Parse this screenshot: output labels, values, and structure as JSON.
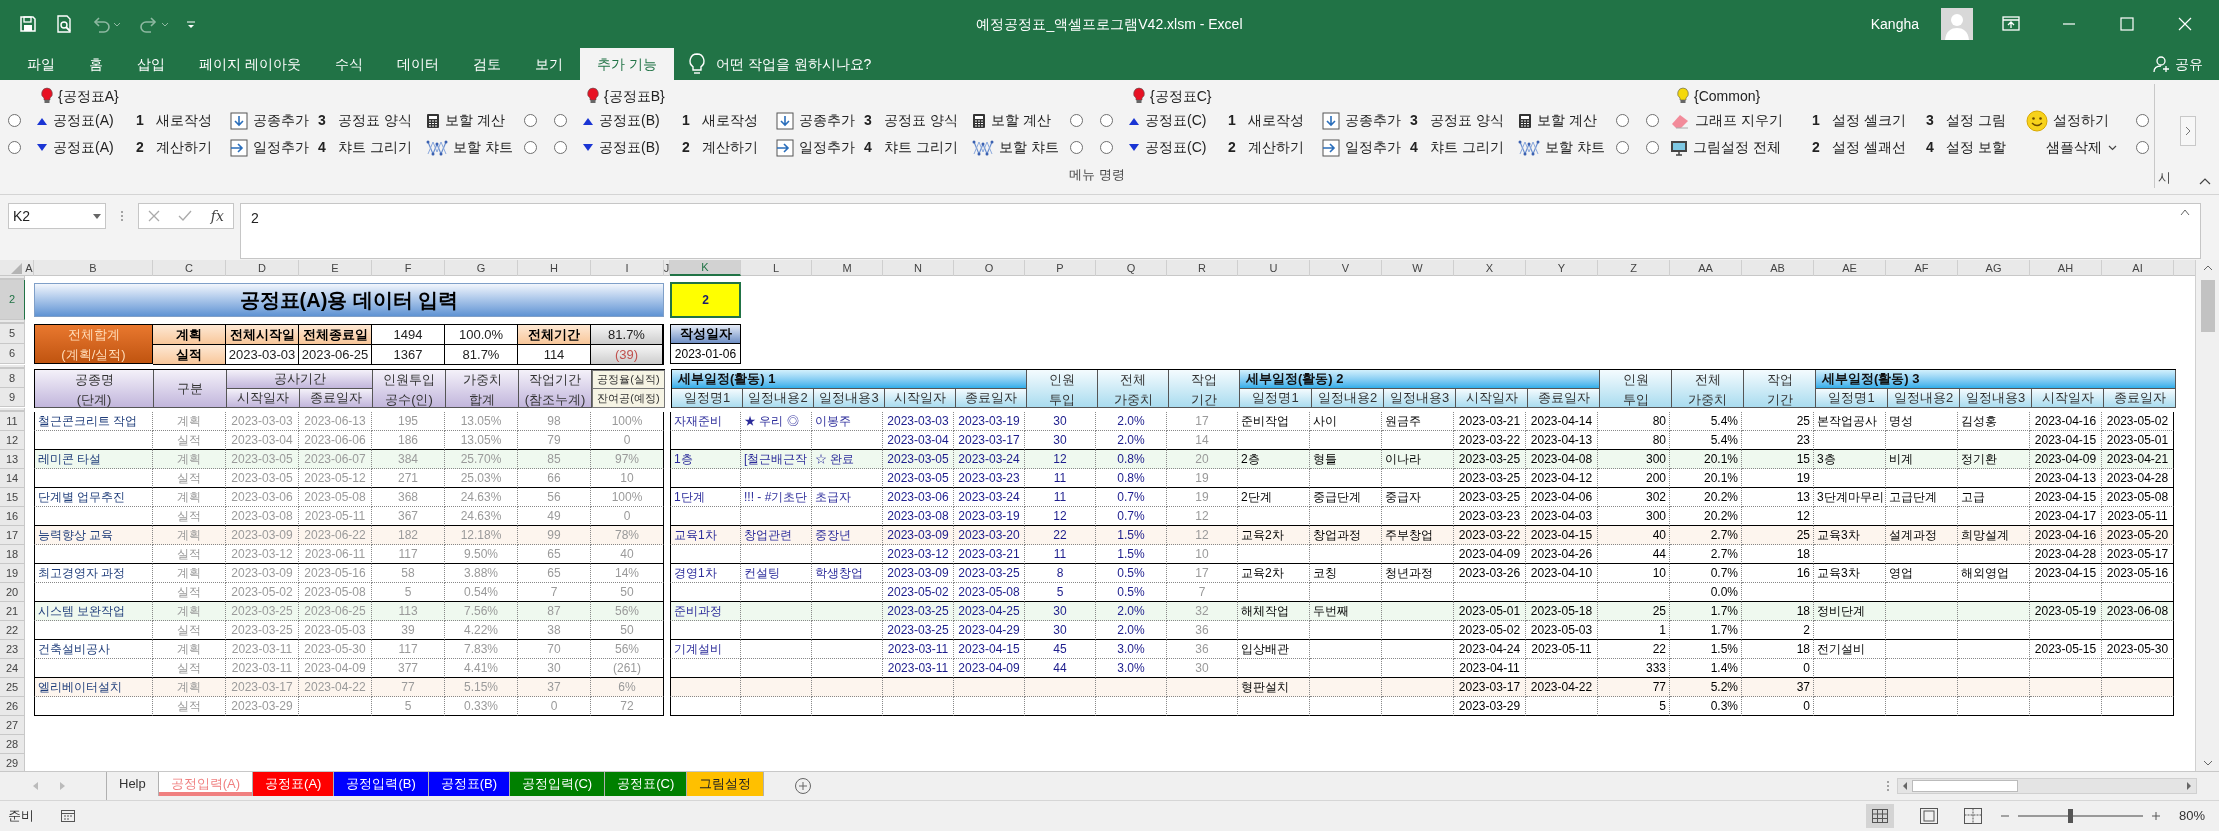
{
  "window": {
    "title": "예정공정표_액셀프로그램V42.xlsm - Excel",
    "user": "Kangha"
  },
  "ribbon_tabs": [
    {
      "label": "파일",
      "selected": false
    },
    {
      "label": "홈",
      "selected": false
    },
    {
      "label": "삽입",
      "selected": false
    },
    {
      "label": "페이지 레이아웃",
      "selected": false
    },
    {
      "label": "수식",
      "selected": false
    },
    {
      "label": "데이터",
      "selected": false
    },
    {
      "label": "검토",
      "selected": false
    },
    {
      "label": "보기",
      "selected": false
    },
    {
      "label": "추가 기능",
      "selected": true
    }
  ],
  "tell_me": "어떤 작업을 원하시나요?",
  "share": "공유",
  "ribbon_groups": [
    {
      "title": "{공정표A}",
      "color": "#e81123",
      "rows": [
        [
          {
            "kind": "radio",
            "checked": false
          },
          {
            "kind": "up",
            "label": "공정표(A)"
          },
          {
            "kind": "numbered",
            "number": "1",
            "label": "새로작성"
          },
          {
            "kind": "insert_down",
            "label": "공종추가"
          },
          {
            "kind": "numbered",
            "number": "3",
            "label": "공정표 양식"
          },
          {
            "kind": "calculator",
            "label": "보할 계산"
          },
          {
            "kind": "radio",
            "checked": false
          }
        ],
        [
          {
            "kind": "radio",
            "checked": false
          },
          {
            "kind": "down",
            "label": "공정표(A)"
          },
          {
            "kind": "numbered",
            "number": "2",
            "label": "계산하기"
          },
          {
            "kind": "insert_right",
            "label": "일정추가"
          },
          {
            "kind": "numbered",
            "number": "4",
            "label": "챠트 그리기"
          },
          {
            "kind": "chart",
            "label": "보할 챠트"
          },
          {
            "kind": "radio",
            "checked": false
          }
        ]
      ]
    },
    {
      "title": "{공정표B}",
      "color": "#e81123",
      "rows": [
        [
          {
            "kind": "radio",
            "checked": false
          },
          {
            "kind": "up",
            "label": "공정표(B)"
          },
          {
            "kind": "numbered",
            "number": "1",
            "label": "새로작성"
          },
          {
            "kind": "insert_down",
            "label": "공종추가"
          },
          {
            "kind": "numbered",
            "number": "3",
            "label": "공정표 양식"
          },
          {
            "kind": "calculator",
            "label": "보할 계산"
          },
          {
            "kind": "radio",
            "checked": false
          }
        ],
        [
          {
            "kind": "radio",
            "checked": false
          },
          {
            "kind": "down",
            "label": "공정표(B)"
          },
          {
            "kind": "numbered",
            "number": "2",
            "label": "계산하기"
          },
          {
            "kind": "insert_right",
            "label": "일정추가"
          },
          {
            "kind": "numbered",
            "number": "4",
            "label": "챠트 그리기"
          },
          {
            "kind": "chart",
            "label": "보할 챠트"
          },
          {
            "kind": "radio",
            "checked": false
          }
        ]
      ]
    },
    {
      "title": "{공정표C}",
      "color": "#e81123",
      "rows": [
        [
          {
            "kind": "radio",
            "checked": false
          },
          {
            "kind": "up",
            "label": "공정표(C)"
          },
          {
            "kind": "numbered",
            "number": "1",
            "label": "새로작성"
          },
          {
            "kind": "insert_down",
            "label": "공종추가"
          },
          {
            "kind": "numbered",
            "number": "3",
            "label": "공정표 양식"
          },
          {
            "kind": "calculator",
            "label": "보할 계산"
          },
          {
            "kind": "radio",
            "checked": false
          }
        ],
        [
          {
            "kind": "radio",
            "checked": false
          },
          {
            "kind": "down",
            "label": "공정표(C)"
          },
          {
            "kind": "numbered",
            "number": "2",
            "label": "계산하기"
          },
          {
            "kind": "insert_right",
            "label": "일정추가"
          },
          {
            "kind": "numbered",
            "number": "4",
            "label": "챠트 그리기"
          },
          {
            "kind": "chart",
            "label": "보할 챠트"
          },
          {
            "kind": "radio",
            "checked": false
          }
        ]
      ]
    },
    {
      "title": "{Common}",
      "color": "#f5d90a",
      "rows": [
        [
          {
            "kind": "radio",
            "checked": false
          },
          {
            "kind": "eraser",
            "label": "그래프 지우기"
          },
          {
            "kind": "numbered",
            "number": "1",
            "label": "설정 셀크기"
          },
          {
            "kind": "numbered",
            "number": "3",
            "label": "설정 그림"
          },
          {
            "kind": "smiley",
            "label": "설정하기"
          },
          {
            "kind": "radio",
            "checked": false
          }
        ],
        [
          {
            "kind": "radio",
            "checked": false
          },
          {
            "kind": "monitor",
            "label": "그림설정 전체"
          },
          {
            "kind": "numbered",
            "number": "2",
            "label": "설정 셀괘선"
          },
          {
            "kind": "numbered",
            "number": "4",
            "label": "설정 보할"
          },
          {
            "kind": "dropdown",
            "label": "샘플삭제"
          },
          {
            "kind": "radio",
            "checked": false
          }
        ]
      ]
    }
  ],
  "ribbon_footer": "메뉴 명령",
  "ribbon_cut_label": "시",
  "name_box": "K2",
  "insert_function": "fx",
  "formula": "2",
  "columns": [
    {
      "label": "A",
      "selected": false
    },
    {
      "label": "B",
      "selected": false
    },
    {
      "label": "C",
      "selected": false
    },
    {
      "label": "D",
      "selected": false
    },
    {
      "label": "E",
      "selected": false
    },
    {
      "label": "F",
      "selected": false
    },
    {
      "label": "G",
      "selected": false
    },
    {
      "label": "H",
      "selected": false
    },
    {
      "label": "I",
      "selected": false
    },
    {
      "label": "J",
      "selected": false
    },
    {
      "label": "K",
      "selected": true
    },
    {
      "label": "L",
      "selected": false
    },
    {
      "label": "M",
      "selected": false
    },
    {
      "label": "N",
      "selected": false
    },
    {
      "label": "O",
      "selected": false
    },
    {
      "label": "P",
      "selected": false
    },
    {
      "label": "Q",
      "selected": false
    },
    {
      "label": "R",
      "selected": false
    },
    {
      "label": "U",
      "selected": false
    },
    {
      "label": "V",
      "selected": false
    },
    {
      "label": "W",
      "selected": false
    },
    {
      "label": "X",
      "selected": false
    },
    {
      "label": "Y",
      "selected": false
    },
    {
      "label": "Z",
      "selected": false
    },
    {
      "label": "AA",
      "selected": false
    },
    {
      "label": "AB",
      "selected": false
    },
    {
      "label": "AE",
      "selected": false
    },
    {
      "label": "AF",
      "selected": false
    },
    {
      "label": "AG",
      "selected": false
    },
    {
      "label": "AH",
      "selected": false
    },
    {
      "label": "AI",
      "selected": false
    }
  ],
  "rows": [
    {
      "label": "2",
      "selected": true
    },
    {
      "label": "5",
      "selected": false
    },
    {
      "label": "6",
      "selected": false
    },
    {
      "label": "8",
      "selected": false
    },
    {
      "label": "9",
      "selected": false
    },
    {
      "label": "11",
      "selected": false
    },
    {
      "label": "12",
      "selected": false
    },
    {
      "label": "13",
      "selected": false
    },
    {
      "label": "14",
      "selected": false
    },
    {
      "label": "15",
      "selected": false
    },
    {
      "label": "16",
      "selected": false
    },
    {
      "label": "17",
      "selected": false
    },
    {
      "label": "18",
      "selected": false
    },
    {
      "label": "19",
      "selected": false
    },
    {
      "label": "20",
      "selected": false
    },
    {
      "label": "21",
      "selected": false
    },
    {
      "label": "22",
      "selected": false
    },
    {
      "label": "23",
      "selected": false
    },
    {
      "label": "24",
      "selected": false
    },
    {
      "label": "25",
      "selected": false
    },
    {
      "label": "26",
      "selected": false
    },
    {
      "label": "27",
      "selected": false
    },
    {
      "label": "28",
      "selected": false
    },
    {
      "label": "29",
      "selected": false
    }
  ],
  "sheet": {
    "banner": "공정표(A)용 데이터 입력",
    "active_cell": "2",
    "date_label": "작성일자",
    "date_value": "2023-01-06",
    "summary": {
      "label": "전체합계",
      "sublabel": "(계획/실적)",
      "rows": [
        {
          "type": "계획",
          "cells": [
            {
              "text": "전체시작일",
              "kind": "label"
            },
            {
              "text": "전체종료일",
              "kind": "label"
            },
            {
              "text": "1494",
              "kind": "value"
            },
            {
              "text": "100.0%",
              "kind": "value"
            },
            {
              "text": "전체기간",
              "kind": "label"
            },
            {
              "text": "81.7%",
              "kind": "rate"
            }
          ]
        },
        {
          "type": "실적",
          "cells": [
            {
              "text": "2023-03-03",
              "kind": "value"
            },
            {
              "text": "2023-06-25",
              "kind": "value"
            },
            {
              "text": "1367",
              "kind": "value"
            },
            {
              "text": "81.7%",
              "kind": "value"
            },
            {
              "text": "114",
              "kind": "value"
            },
            {
              "text": "(39)",
              "kind": "deficit"
            }
          ]
        }
      ]
    },
    "left_header": [
      {
        "top": "공종명",
        "bottom": "(단계)"
      },
      {
        "top": "구분"
      },
      {
        "top": "공사기간",
        "sub": [
          "시작일자",
          "종료일자"
        ]
      },
      {
        "top": "인원투입",
        "bottom": "공수(인)"
      },
      {
        "top": "가중치",
        "bottom": "합계"
      },
      {
        "top": "작업기간",
        "bottom": "(참조누계)"
      },
      {
        "top": "공정율(실적)",
        "bottom": "잔여공(예정)"
      }
    ],
    "detail_groups": [
      {
        "title": "세부일정(활동) 1",
        "columns": [
          "일정명1",
          "일정내용2",
          "일정내용3",
          "시작일자",
          "종료일자"
        ],
        "extras": [
          {
            "top": "인원",
            "bottom": "투입"
          },
          {
            "top": "전체",
            "bottom": "가중치"
          },
          {
            "top": "작업",
            "bottom": "기간"
          }
        ]
      },
      {
        "title": "세부일정(활동) 2",
        "columns": [
          "일정명1",
          "일정내용2",
          "일정내용3",
          "시작일자",
          "종료일자"
        ],
        "extras": [
          {
            "top": "인원",
            "bottom": "투입"
          },
          {
            "top": "전체",
            "bottom": "가중치"
          },
          {
            "top": "작업",
            "bottom": "기간"
          }
        ]
      },
      {
        "title": "세부일정(활동) 3",
        "columns": [
          "일정명1",
          "일정내용2",
          "일정내용3",
          "시작일자",
          "종료일자"
        ]
      }
    ],
    "tasks": [
      {
        "color": "#ffffff",
        "lines": [
          {
            "name": "철근콘크리트 작업",
            "type": "계획",
            "start": "2023-03-03",
            "end": "2023-06-13",
            "manpower": "195",
            "weight": "13.05%",
            "duration": "98",
            "progress": "100%",
            "detail_1": {
              "name": "자재준비",
              "content2": "★ 우리 ◎",
              "content3": "이봉주",
              "start": "2023-03-03",
              "end": "2023-03-19",
              "manpower": "30",
              "weight": "2.0%",
              "duration": "17"
            },
            "detail_2": {
              "name": "준비작업",
              "content2": "사이",
              "content3": "원금주",
              "start": "2023-03-21",
              "end": "2023-04-14",
              "manpower": "80",
              "weight": "5.4%",
              "duration": "25"
            },
            "detail_3": {
              "name": "본작업공사",
              "content2": "명성",
              "content3": "김성홍",
              "start": "2023-04-16",
              "end": "2023-05-02"
            }
          },
          {
            "type": "실적",
            "start": "2023-03-04",
            "end": "2023-06-06",
            "manpower": "186",
            "weight": "13.05%",
            "duration": "79",
            "progress": "0",
            "detail_1": {
              "start": "2023-03-04",
              "end": "2023-03-17",
              "manpower": "30",
              "weight": "2.0%",
              "duration": "14"
            },
            "detail_2": {
              "start": "2023-03-22",
              "end": "2023-04-13",
              "manpower": "80",
              "weight": "5.4%",
              "duration": "23"
            },
            "detail_3": {
              "start": "2023-04-15",
              "end": "2023-05-01"
            }
          }
        ]
      },
      {
        "color": "#eff9ef",
        "lines": [
          {
            "name": "레미콘 타설",
            "type": "계획",
            "start": "2023-03-05",
            "end": "2023-06-07",
            "manpower": "384",
            "weight": "25.70%",
            "duration": "85",
            "progress": "97%",
            "detail_1": {
              "name": "1층",
              "content2": "[철근배근작",
              "content3": "☆ 완료",
              "start": "2023-03-05",
              "end": "2023-03-24",
              "manpower": "12",
              "weight": "0.8%",
              "duration": "20"
            },
            "detail_2": {
              "name": "2층",
              "content2": "형틀",
              "content3": "이나라",
              "start": "2023-03-25",
              "end": "2023-04-08",
              "manpower": "300",
              "weight": "20.1%",
              "duration": "15"
            },
            "detail_3": {
              "name": "3층",
              "content2": "비계",
              "content3": "정기환",
              "start": "2023-04-09",
              "end": "2023-04-21"
            }
          },
          {
            "type": "실적",
            "start": "2023-03-05",
            "end": "2023-05-12",
            "manpower": "271",
            "weight": "25.03%",
            "duration": "66",
            "progress": "10",
            "detail_1": {
              "start": "2023-03-05",
              "end": "2023-03-23",
              "manpower": "11",
              "weight": "0.8%",
              "duration": "19"
            },
            "detail_2": {
              "start": "2023-03-25",
              "end": "2023-04-12",
              "manpower": "200",
              "weight": "20.1%",
              "duration": "19"
            },
            "detail_3": {
              "start": "2023-04-13",
              "end": "2023-04-28"
            }
          }
        ]
      },
      {
        "color": "#ffffff",
        "lines": [
          {
            "name": "단계별 업무추진",
            "type": "계획",
            "start": "2023-03-06",
            "end": "2023-05-08",
            "manpower": "368",
            "weight": "24.63%",
            "duration": "56",
            "progress": "100%",
            "detail_1": {
              "name": "1단계",
              "content2": "!!! - #기초단",
              "content3": "초급자",
              "start": "2023-03-06",
              "end": "2023-03-24",
              "manpower": "11",
              "weight": "0.7%",
              "duration": "19"
            },
            "detail_2": {
              "name": "2단계",
              "content2": "중급단계",
              "content3": "중급자",
              "start": "2023-03-25",
              "end": "2023-04-06",
              "manpower": "302",
              "weight": "20.2%",
              "duration": "13"
            },
            "detail_3": {
              "name": "3단계마무리",
              "content2": "고급단계",
              "content3": "고급",
              "start": "2023-04-15",
              "end": "2023-05-08"
            }
          },
          {
            "type": "실적",
            "start": "2023-03-08",
            "end": "2023-05-11",
            "manpower": "367",
            "weight": "24.63%",
            "duration": "49",
            "progress": "0",
            "detail_1": {
              "start": "2023-03-08",
              "end": "2023-03-19",
              "manpower": "12",
              "weight": "0.7%",
              "duration": "12"
            },
            "detail_2": {
              "start": "2023-03-23",
              "end": "2023-04-03",
              "manpower": "300",
              "weight": "20.2%",
              "duration": "12"
            },
            "detail_3": {
              "start": "2023-04-17",
              "end": "2023-05-11"
            }
          }
        ]
      },
      {
        "color": "#fdf5ee",
        "lines": [
          {
            "name": "능력향상 교육",
            "type": "계획",
            "start": "2023-03-09",
            "end": "2023-06-22",
            "manpower": "182",
            "weight": "12.18%",
            "duration": "99",
            "progress": "78%",
            "detail_1": {
              "name": "교육1차",
              "content2": "창업관련",
              "content3": "중장년",
              "start": "2023-03-09",
              "end": "2023-03-20",
              "manpower": "22",
              "weight": "1.5%",
              "duration": "12"
            },
            "detail_2": {
              "name": "교육2차",
              "content2": "창업과정",
              "content3": "주부창업",
              "start": "2023-03-22",
              "end": "2023-04-15",
              "manpower": "40",
              "weight": "2.7%",
              "duration": "25"
            },
            "detail_3": {
              "name": "교육3차",
              "content2": "설계과정",
              "content3": "희망설계",
              "start": "2023-04-16",
              "end": "2023-05-20"
            }
          },
          {
            "type": "실적",
            "start": "2023-03-12",
            "end": "2023-06-11",
            "manpower": "117",
            "weight": "9.50%",
            "duration": "65",
            "progress": "40",
            "detail_1": {
              "start": "2023-03-12",
              "end": "2023-03-21",
              "manpower": "11",
              "weight": "1.5%",
              "duration": "10"
            },
            "detail_2": {
              "start": "2023-04-09",
              "end": "2023-04-26",
              "manpower": "44",
              "weight": "2.7%",
              "duration": "18"
            },
            "detail_3": {
              "start": "2023-04-28",
              "end": "2023-05-17"
            }
          }
        ]
      },
      {
        "color": "#ffffff",
        "lines": [
          {
            "name": "최고경영자 과정",
            "type": "계획",
            "start": "2023-03-09",
            "end": "2023-05-16",
            "manpower": "58",
            "weight": "3.88%",
            "duration": "65",
            "progress": "14%",
            "detail_1": {
              "name": "경영1차",
              "content2": "컨설팅",
              "content3": "학생창업",
              "start": "2023-03-09",
              "end": "2023-03-25",
              "manpower": "8",
              "weight": "0.5%",
              "duration": "17"
            },
            "detail_2": {
              "name": "교육2차",
              "content2": "코칭",
              "content3": "청년과정",
              "start": "2023-03-26",
              "end": "2023-04-10",
              "manpower": "10",
              "weight": "0.7%",
              "duration": "16"
            },
            "detail_3": {
              "name": "교육3차",
              "content2": "영업",
              "content3": "해외영업",
              "start": "2023-04-15",
              "end": "2023-05-16"
            }
          },
          {
            "type": "실적",
            "start": "2023-05-02",
            "end": "2023-05-08",
            "manpower": "5",
            "weight": "0.54%",
            "duration": "7",
            "progress": "50",
            "detail_1": {
              "start": "2023-05-02",
              "end": "2023-05-08",
              "manpower": "5",
              "weight": "0.5%",
              "duration": "7"
            },
            "detail_2": {
              "weight": "0.0%"
            }
          }
        ]
      },
      {
        "color": "#eff9ef",
        "lines": [
          {
            "name": "시스템 보완작업",
            "type": "계획",
            "start": "2023-03-25",
            "end": "2023-06-25",
            "manpower": "113",
            "weight": "7.56%",
            "duration": "87",
            "progress": "56%",
            "detail_1": {
              "name": "준비과정",
              "start": "2023-03-25",
              "end": "2023-04-25",
              "manpower": "30",
              "weight": "2.0%",
              "duration": "32"
            },
            "detail_2": {
              "name": "해체작업",
              "content2": "두번째",
              "start": "2023-05-01",
              "end": "2023-05-18",
              "manpower": "25",
              "weight": "1.7%",
              "duration": "18"
            },
            "detail_3": {
              "name": "정비단계",
              "start": "2023-05-19",
              "end": "2023-06-08"
            }
          },
          {
            "type": "실적",
            "start": "2023-03-25",
            "end": "2023-05-03",
            "manpower": "39",
            "weight": "4.22%",
            "duration": "38",
            "progress": "50",
            "detail_1": {
              "start": "2023-03-25",
              "end": "2023-04-29",
              "manpower": "30",
              "weight": "2.0%",
              "duration": "36"
            },
            "detail_2": {
              "start": "2023-05-02",
              "end": "2023-05-03",
              "manpower": "1",
              "weight": "1.7%",
              "duration": "2"
            }
          }
        ]
      },
      {
        "color": "#ffffff",
        "lines": [
          {
            "name": "건축설비공사",
            "type": "계획",
            "start": "2023-03-11",
            "end": "2023-05-30",
            "manpower": "117",
            "weight": "7.83%",
            "duration": "70",
            "progress": "56%",
            "detail_1": {
              "name": "기계설비",
              "start": "2023-03-11",
              "end": "2023-04-15",
              "manpower": "45",
              "weight": "3.0%",
              "duration": "36"
            },
            "detail_2": {
              "name": "입상배관",
              "start": "2023-04-24",
              "end": "2023-05-11",
              "manpower": "22",
              "weight": "1.5%",
              "duration": "18"
            },
            "detail_3": {
              "name": "전기설비",
              "start": "2023-05-15",
              "end": "2023-05-30"
            }
          },
          {
            "type": "실적",
            "start": "2023-03-11",
            "end": "2023-04-09",
            "manpower": "377",
            "weight": "4.41%",
            "duration": "30",
            "progress": "(261)",
            "detail_1": {
              "start": "2023-03-11",
              "end": "2023-04-09",
              "manpower": "44",
              "weight": "3.0%",
              "duration": "30"
            },
            "detail_2": {
              "start": "2023-04-11",
              "manpower": "333",
              "weight": "1.4%",
              "duration": "0"
            }
          }
        ]
      },
      {
        "color": "#fdf5ee",
        "lines": [
          {
            "name": "엘리베이터설치",
            "type": "계획",
            "start": "2023-03-17",
            "end": "2023-04-22",
            "manpower": "77",
            "weight": "5.15%",
            "duration": "37",
            "progress": "6%",
            "detail_2": {
              "name": "형판설치",
              "start": "2023-03-17",
              "end": "2023-04-22",
              "manpower": "77",
              "weight": "5.2%",
              "duration": "37"
            }
          },
          {
            "type": "실적",
            "start": "2023-03-29",
            "manpower": "5",
            "weight": "0.33%",
            "duration": "0",
            "progress": "72",
            "detail_2": {
              "start": "2023-03-29",
              "manpower": "5",
              "weight": "0.3%",
              "duration": "0"
            }
          }
        ]
      }
    ]
  },
  "sheet_tabs": [
    {
      "label": "Help",
      "selected": false
    },
    {
      "label": "공정입력(A)",
      "selected": true,
      "color": "#f08080"
    },
    {
      "label": "공정표(A)",
      "selected": false,
      "color": "#ff0000"
    },
    {
      "label": "공정입력(B)",
      "selected": false,
      "color": "#0000ff"
    },
    {
      "label": "공정표(B)",
      "selected": false,
      "color": "#0000ff"
    },
    {
      "label": "공정입력(C)",
      "selected": false,
      "color": "#008000"
    },
    {
      "label": "공정표(C)",
      "selected": false,
      "color": "#008000"
    },
    {
      "label": "그림설정",
      "selected": false,
      "color": "#ffc000"
    }
  ],
  "status": "준비",
  "zoom": {
    "level": 0.42,
    "reading": "80%"
  }
}
